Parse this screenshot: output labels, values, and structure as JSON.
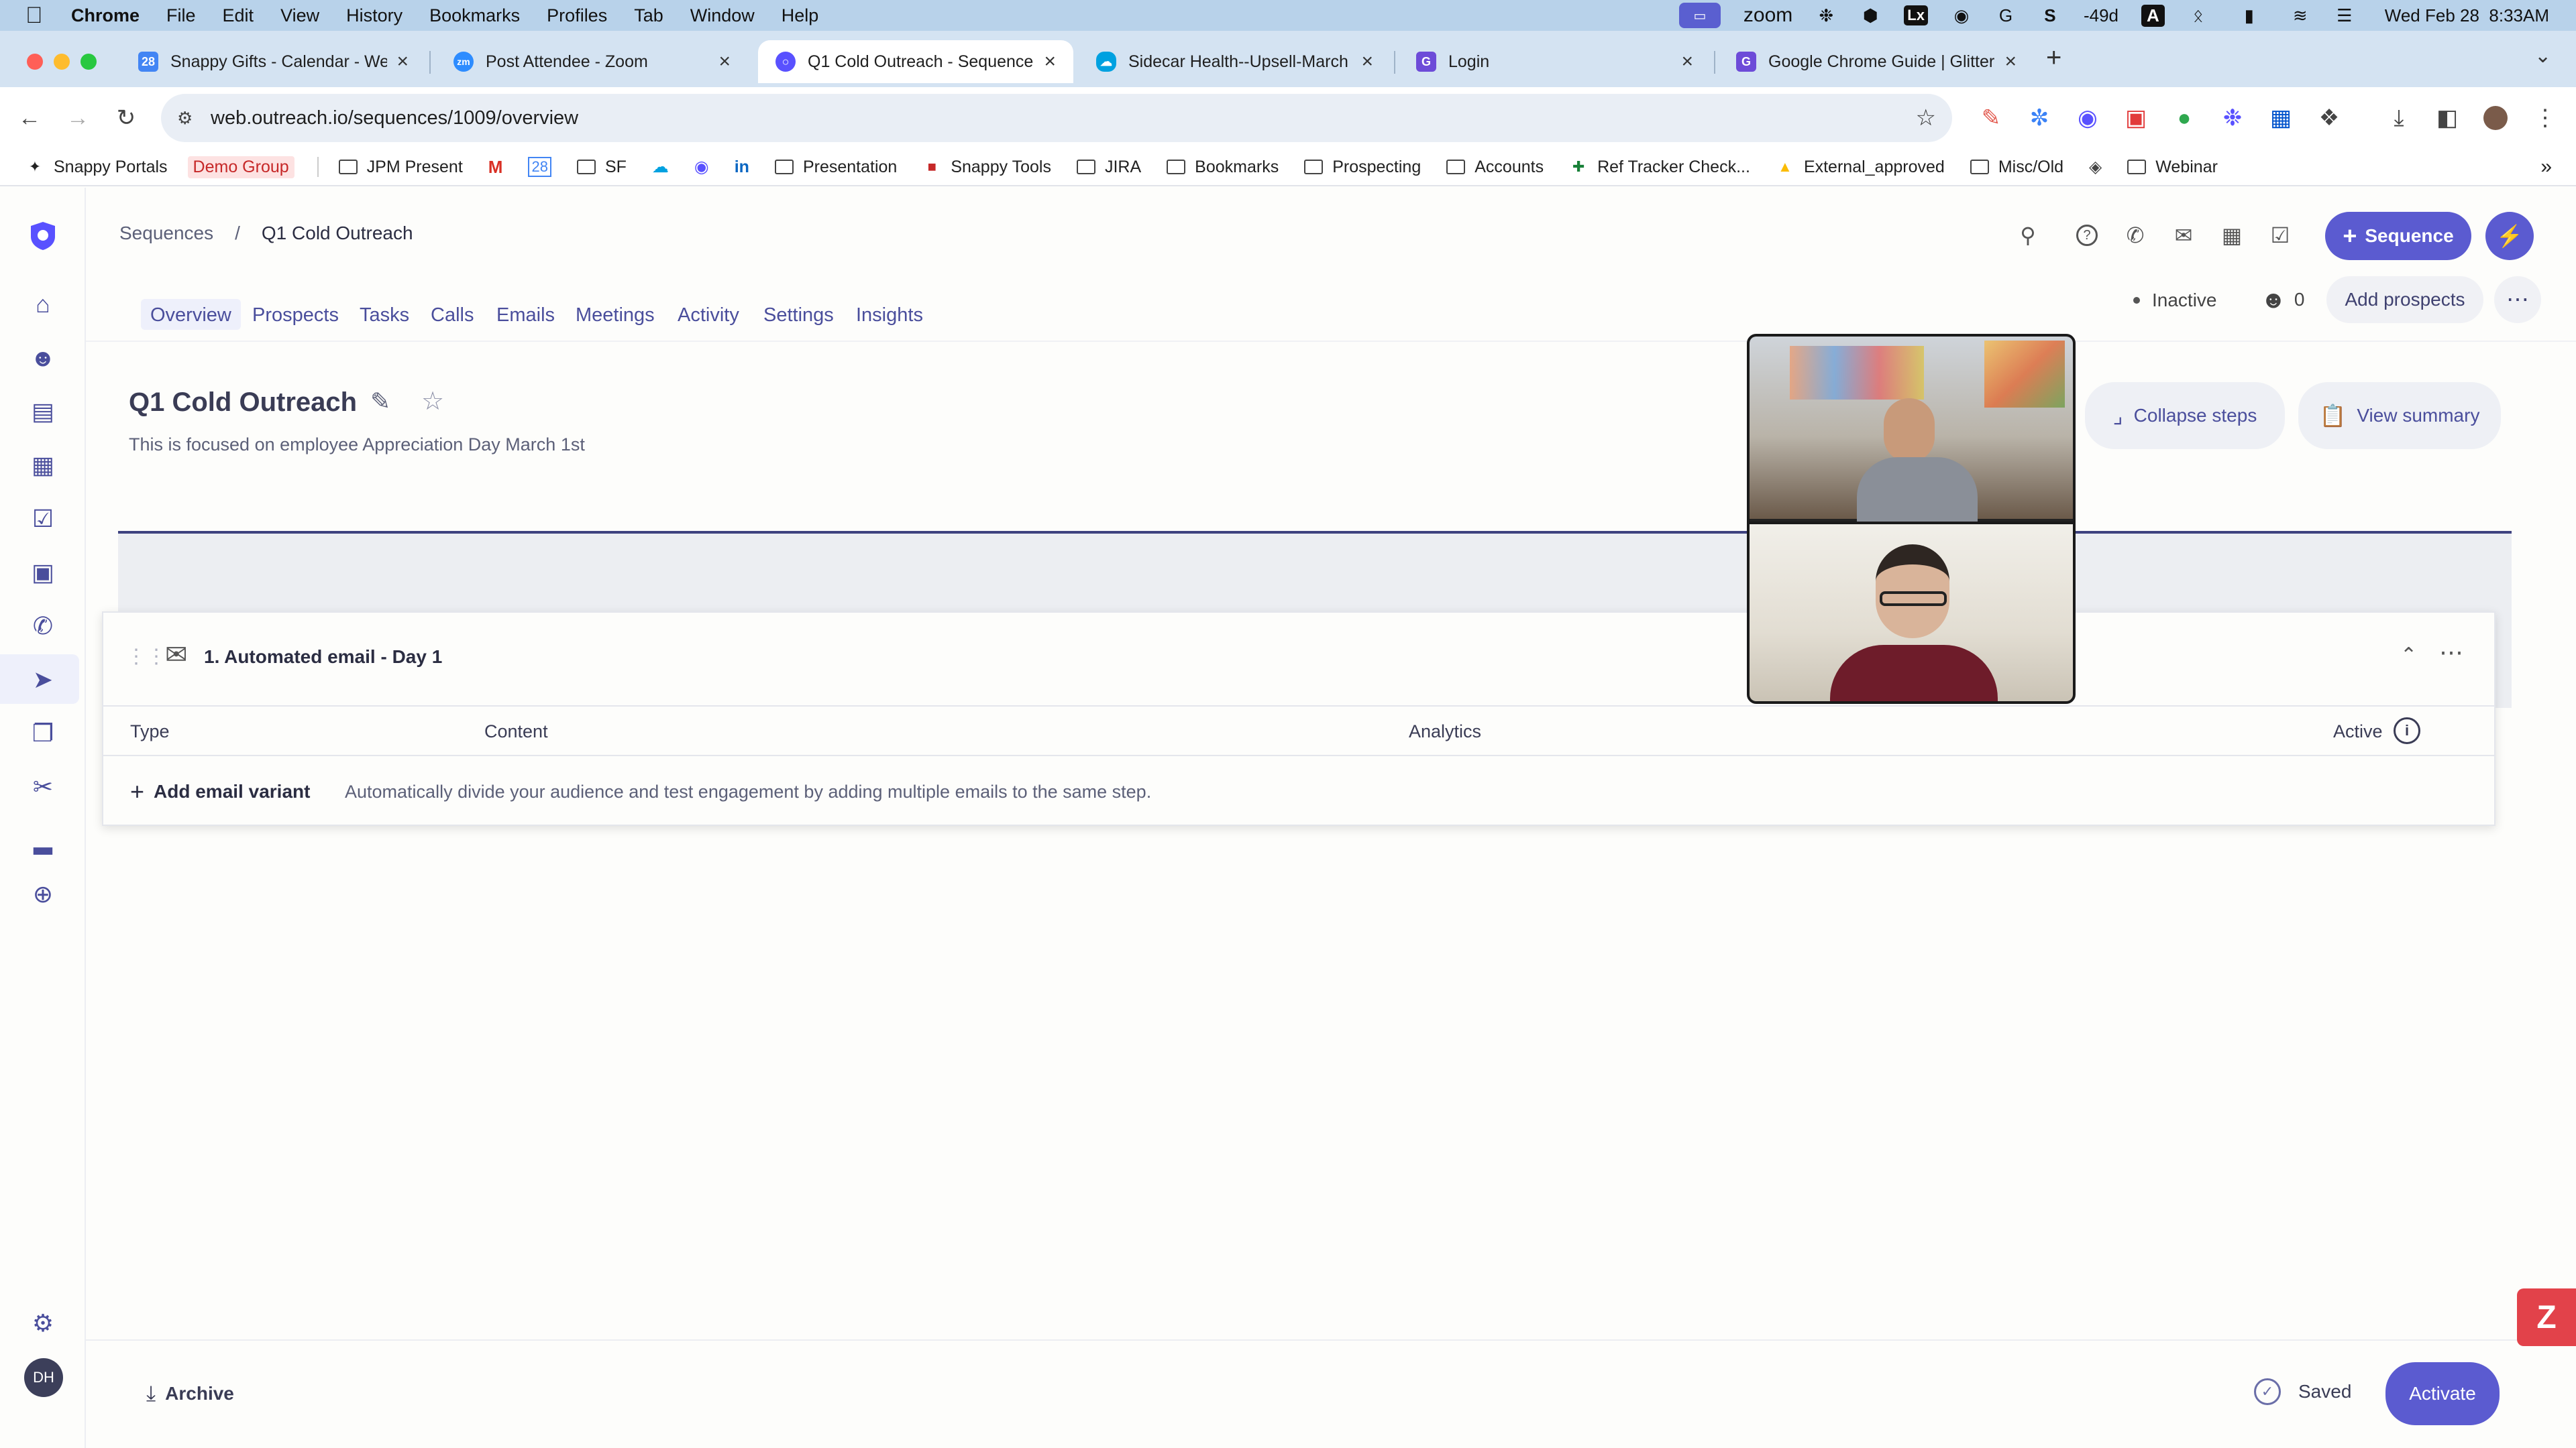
{
  "menubar": {
    "app": "Chrome",
    "items": [
      "File",
      "Edit",
      "View",
      "History",
      "Bookmarks",
      "Profiles",
      "Tab",
      "Window",
      "Help"
    ],
    "zoom_label": "zoom",
    "lx": "Lx",
    "countdown": "-49d",
    "a_label": "A",
    "datetime": "Wed Feb 28  8:33AM"
  },
  "tabs": [
    {
      "title": "Snappy Gifts - Calendar - We",
      "icon": "calendar-icon",
      "color": "#4285f4"
    },
    {
      "title": "Post Attendee - Zoom",
      "icon": "zoom-icon",
      "color": "#2d8cff"
    },
    {
      "title": "Q1 Cold Outreach - Sequence",
      "icon": "outreach-icon",
      "color": "#5951ff"
    },
    {
      "title": "Sidecar Health--Upsell-March",
      "icon": "salesforce-icon",
      "color": "#00a1e0"
    },
    {
      "title": "Login",
      "icon": "glitter-icon",
      "color": "#6d4bd8"
    },
    {
      "title": "Google Chrome Guide | Glitter",
      "icon": "glitter-icon",
      "color": "#6d4bd8"
    }
  ],
  "address": {
    "url": "web.outreach.io/sequences/1009/overview"
  },
  "bookmarks": [
    "Snappy Portals",
    "Demo Group",
    "JPM Present",
    "SF",
    "Presentation",
    "Snappy Tools",
    "JIRA",
    "Bookmarks",
    "Prospecting",
    "Accounts",
    "Ref Tracker Check...",
    "External_approved",
    "Misc/Old",
    "Webinar"
  ],
  "breadcrumb": {
    "root": "Sequences",
    "sep": "/",
    "current": "Q1 Cold Outreach"
  },
  "header": {
    "sequence_button": "Sequence"
  },
  "nav": [
    "Overview",
    "Prospects",
    "Tasks",
    "Calls",
    "Emails",
    "Meetings",
    "Activity",
    "Settings",
    "Insights"
  ],
  "status": {
    "state": "Inactive",
    "prospect_count": "0",
    "add_prospects": "Add prospects"
  },
  "sequence": {
    "title": "Q1 Cold Outreach",
    "description": "This is focused on employee Appreciation Day March 1st",
    "collapse_steps": "Collapse steps",
    "view_summary": "View summary"
  },
  "step": {
    "title": "1. Automated email - Day 1",
    "columns": {
      "type": "Type",
      "content": "Content",
      "analytics": "Analytics",
      "active": "Active"
    },
    "add_variant": "Add email variant",
    "variant_hint": "Automatically divide your audience and test engagement by adding multiple emails to the same step."
  },
  "footer": {
    "archive": "Archive",
    "saved": "Saved",
    "activate": "Activate"
  },
  "user": {
    "initials": "DH"
  },
  "colors": {
    "accent": "#5b5bd0",
    "nav_text": "#4a4e9c",
    "menubar": "#b8d2ea",
    "tabstrip": "#d4e3f2"
  }
}
